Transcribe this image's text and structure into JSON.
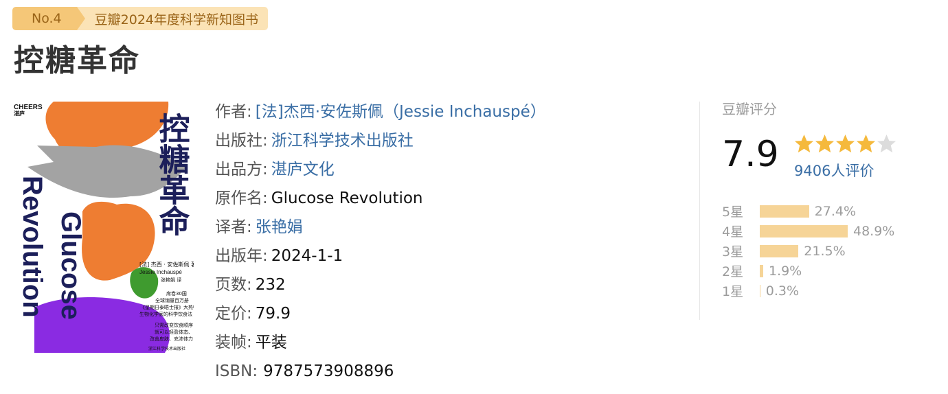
{
  "badge": {
    "rank": "No.4",
    "list": "豆瓣2024年度科学新知图书"
  },
  "book": {
    "title": "控糖革命"
  },
  "cover": {
    "publisher_logo": "CHEERS",
    "publisher_logo_cn": "湛庐",
    "title_cn": "控糖革命",
    "title_en_1": "Glucose",
    "title_en_2": "Revolution",
    "author_cn": "[法] 杰西 · 安佐斯佩 著",
    "author_en": "Jessie Inchauspé",
    "translator": "张艳娟 译",
    "blurb_1": "席卷30国",
    "blurb_2": "全球销量百万册",
    "blurb_3": "《星期日泰晤士报》大热畅销书",
    "blurb_4": "生物化学家的科学饮食法",
    "blurb_5": "只需改变饮食顺序",
    "blurb_6": "就可以轻盈体态、",
    "blurb_7": "改善皮肤、充沛体力",
    "publisher": "浙江科学技术出版社"
  },
  "info": {
    "author_label": "作者:",
    "author_value": "[法]杰西·安佐斯佩（Jessie Inchauspé）",
    "publisher_label": "出版社:",
    "publisher_value": "浙江科学技术出版社",
    "producer_label": "出品方:",
    "producer_value": "湛庐文化",
    "original_title_label": "原作名:",
    "original_title_value": "Glucose Revolution",
    "translator_label": "译者:",
    "translator_value": "张艳娟",
    "pub_year_label": "出版年:",
    "pub_year_value": "2024-1-1",
    "pages_label": "页数:",
    "pages_value": "232",
    "price_label": "定价:",
    "price_value": "79.9",
    "binding_label": "装帧:",
    "binding_value": "平装",
    "isbn_label": "ISBN:",
    "isbn_value": "9787573908896"
  },
  "rating": {
    "heading": "豆瓣评分",
    "score": "7.9",
    "stars_filled": 4,
    "stars_total": 5,
    "votes": "9406人评价",
    "distribution": [
      {
        "label": "5星",
        "percent": "27.4%",
        "value": 27.4
      },
      {
        "label": "4星",
        "percent": "48.9%",
        "value": 48.9
      },
      {
        "label": "3星",
        "percent": "21.5%",
        "value": 21.5
      },
      {
        "label": "2星",
        "percent": "1.9%",
        "value": 1.9
      },
      {
        "label": "1星",
        "percent": "0.3%",
        "value": 0.3
      }
    ]
  },
  "colors": {
    "link": "#3a6ea5",
    "star": "#f5b93c",
    "star_empty": "#dcdcdc",
    "bar": "#f6d497",
    "badge_dark": "#f5c778",
    "badge_light": "#fbe3b6",
    "cover_orange": "#ee7d32",
    "cover_gray": "#a3a3a3",
    "cover_green": "#3f9b2f",
    "cover_purple": "#8a2be2",
    "cover_navy": "#1c1f5a"
  }
}
